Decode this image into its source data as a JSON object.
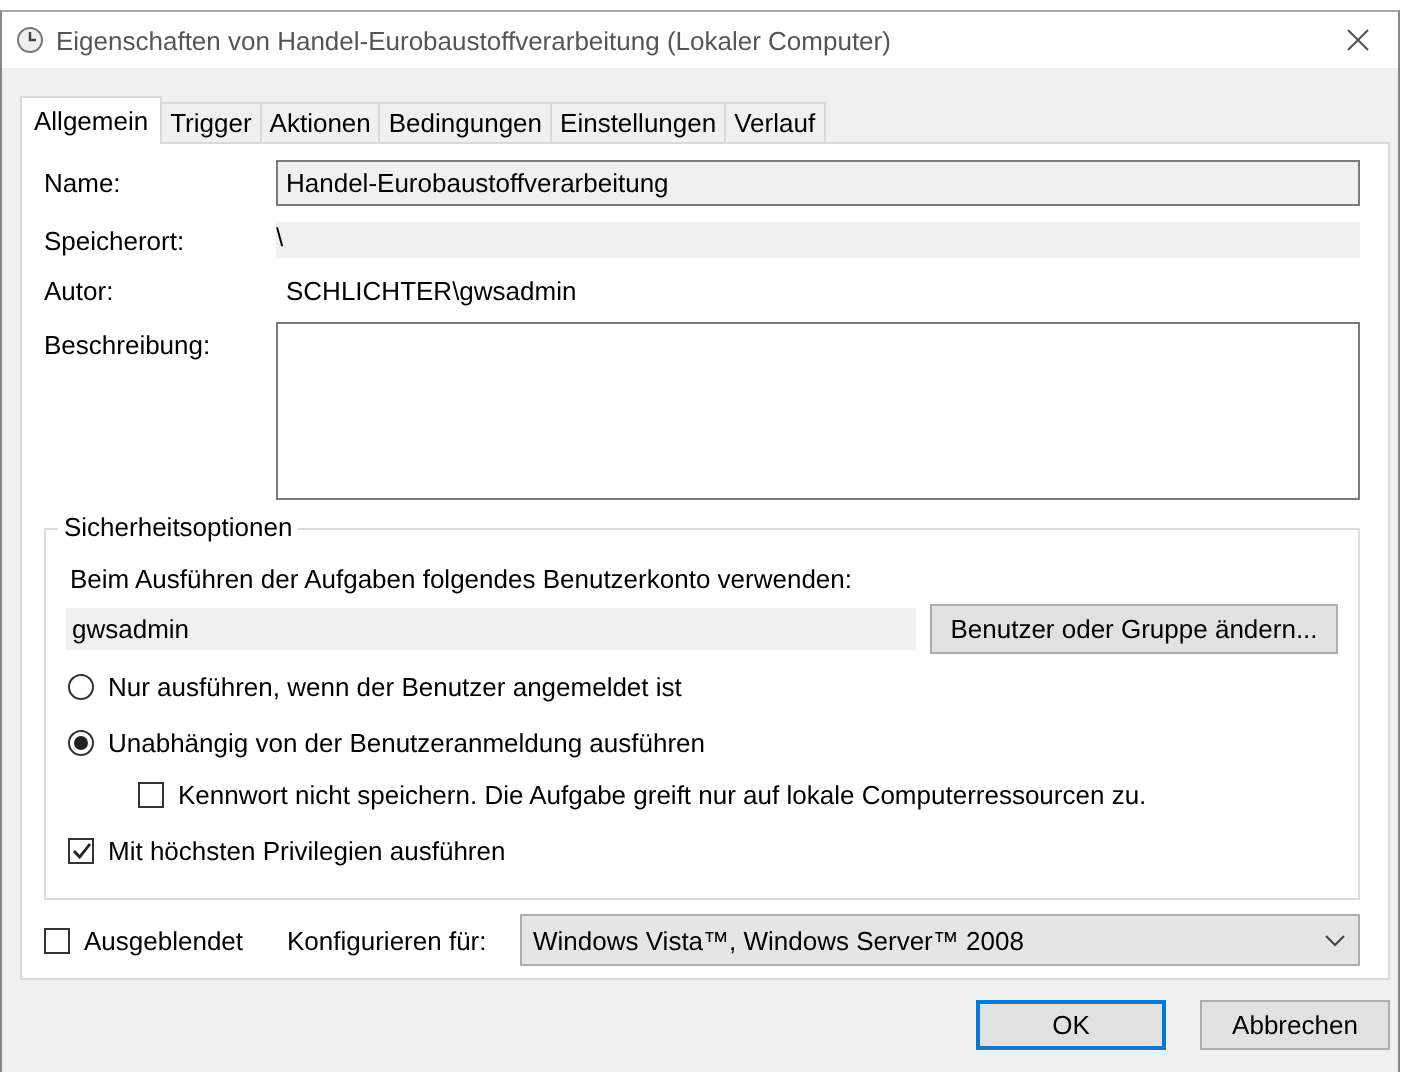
{
  "window": {
    "title": "Eigenschaften von Handel-Eurobaustoffverarbeitung (Lokaler Computer)"
  },
  "tabs": [
    {
      "label": "Allgemein",
      "selected": true
    },
    {
      "label": "Trigger",
      "selected": false
    },
    {
      "label": "Aktionen",
      "selected": false
    },
    {
      "label": "Bedingungen",
      "selected": false
    },
    {
      "label": "Einstellungen",
      "selected": false
    },
    {
      "label": "Verlauf",
      "selected": false
    }
  ],
  "fields": [
    {
      "kind": "box",
      "label": "Name:",
      "value": "Handel-Eurobaustoffverarbeitung"
    },
    {
      "kind": "plain",
      "label": "Speicherort:",
      "value": "\\"
    },
    {
      "kind": "text",
      "label": "Autor:",
      "value": "SCHLICHTER\\gwsadmin"
    },
    {
      "kind": "area",
      "label": "Beschreibung:"
    }
  ],
  "security": {
    "title": "Sicherheitsoptionen",
    "prompt": "Beim Ausführen der Aufgaben folgendes Benutzerkonto verwenden:",
    "account": "gwsadmin",
    "change_button": "Benutzer oder Gruppe ändern...",
    "options": [
      {
        "kind": "radio",
        "label": "Nur ausführen, wenn der Benutzer angemeldet ist",
        "selected": false
      },
      {
        "kind": "radio",
        "label": "Unabhängig von der Benutzeranmeldung ausführen",
        "selected": true,
        "children": [
          {
            "label": "Kennwort nicht speichern. Die Aufgabe greift nur auf lokale Computerressourcen zu.",
            "checked": false
          }
        ]
      },
      {
        "kind": "checkbox",
        "label": "Mit höchsten Privilegien ausführen",
        "checked": true
      }
    ]
  },
  "hidden": {
    "label": "Ausgeblendet",
    "checked": false
  },
  "configure": {
    "label": "Konfigurieren für:",
    "value": "Windows Vista™, Windows Server™ 2008"
  },
  "buttons": [
    {
      "label": "OK",
      "default": true
    },
    {
      "label": "Abbrechen",
      "default": false
    }
  ]
}
